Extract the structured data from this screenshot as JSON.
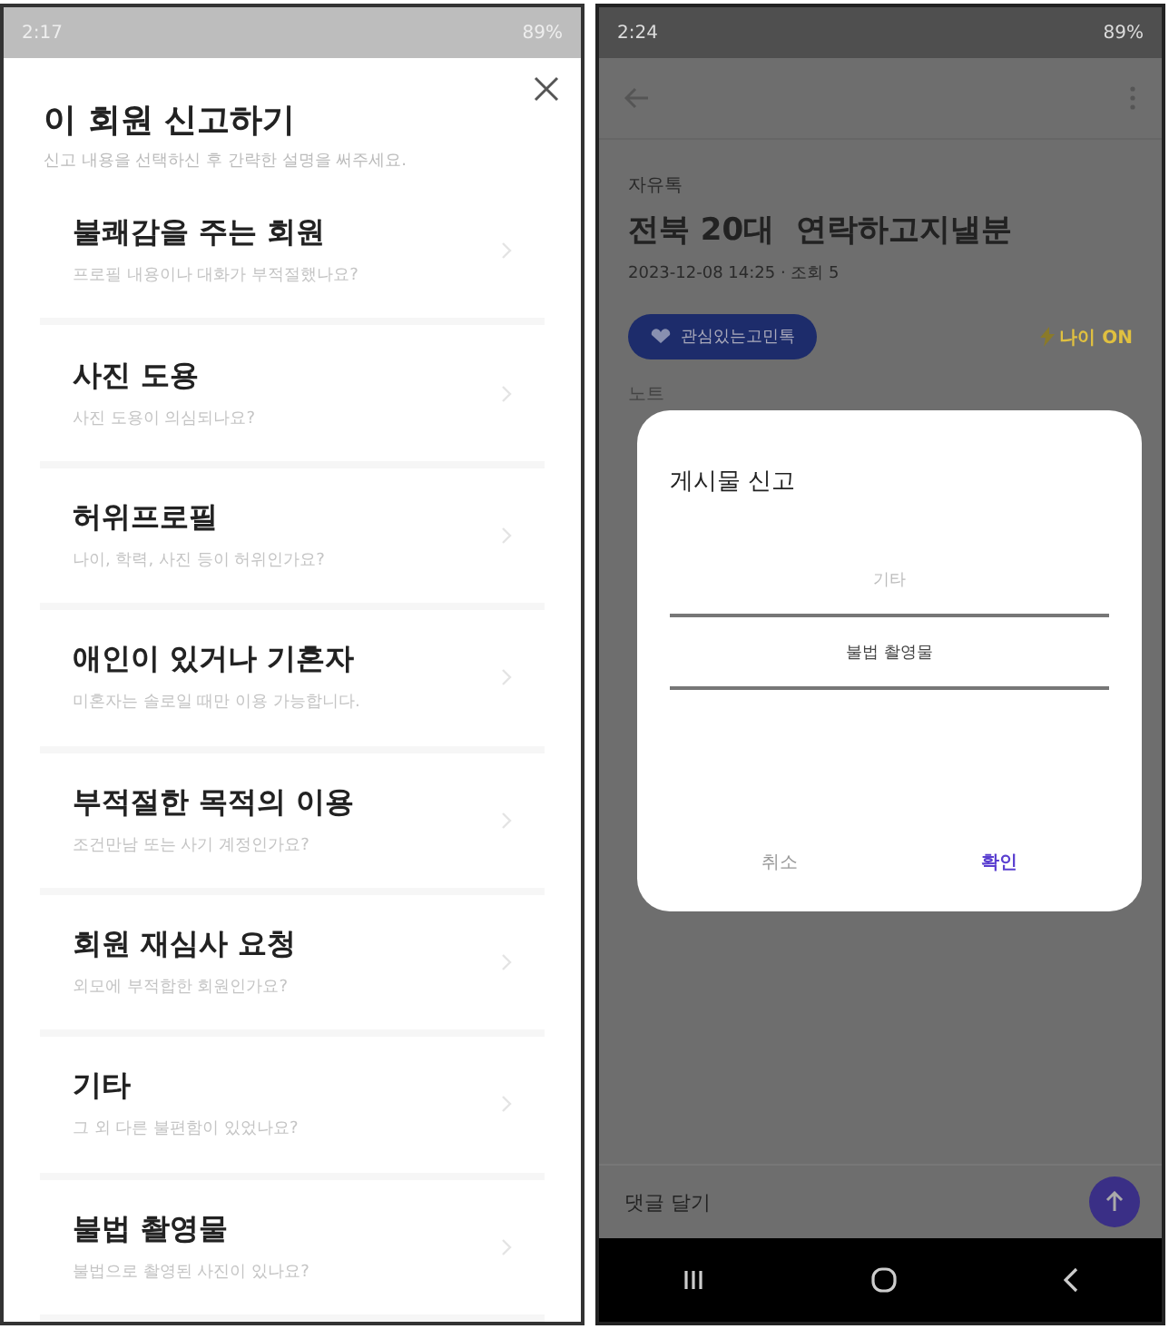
{
  "left_screen": {
    "status_bar": {
      "time": "2:17",
      "battery": "89%"
    },
    "title": "이 회원 신고하기",
    "subtitle": "신고 내용을 선택하신 후 간략한 설명을 써주세요.",
    "reasons": [
      {
        "title": "불쾌감을 주는 회원",
        "description": "프로필 내용이나 대화가 부적절했나요?"
      },
      {
        "title": "사진 도용",
        "description": "사진 도용이 의심되나요?"
      },
      {
        "title": "허위프로필",
        "description": "나이, 학력, 사진 등이 허위인가요?"
      },
      {
        "title": "애인이 있거나 기혼자",
        "description": "미혼자는 솔로일 때만 이용 가능합니다."
      },
      {
        "title": "부적절한 목적의 이용",
        "description": "조건만남 또는 사기 계정인가요?"
      },
      {
        "title": "회원 재심사 요청",
        "description": "외모에 부적합한 회원인가요?"
      },
      {
        "title": "기타",
        "description": "그 외 다른 불편함이 있었나요?"
      },
      {
        "title": "불법 촬영물",
        "description": "불법으로 촬영된 사진이 있나요?"
      }
    ]
  },
  "right_screen": {
    "status_bar": {
      "time": "2:24",
      "battery": "89%"
    },
    "post": {
      "category": "자유톡",
      "title": "전북 20대  연락하고지낼분",
      "meta": "2023-12-08 14:25 · 조회 5",
      "tag": "관심있는고민톡",
      "badge": "나이 ON",
      "section": "노트"
    },
    "dialog": {
      "title": "게시물 신고",
      "options": [
        {
          "label": "기타",
          "selected": false
        },
        {
          "label": "불법 촬영물",
          "selected": true
        }
      ],
      "cancel": "취소",
      "confirm": "확인"
    },
    "comment": {
      "placeholder": "댓글 달기"
    }
  }
}
